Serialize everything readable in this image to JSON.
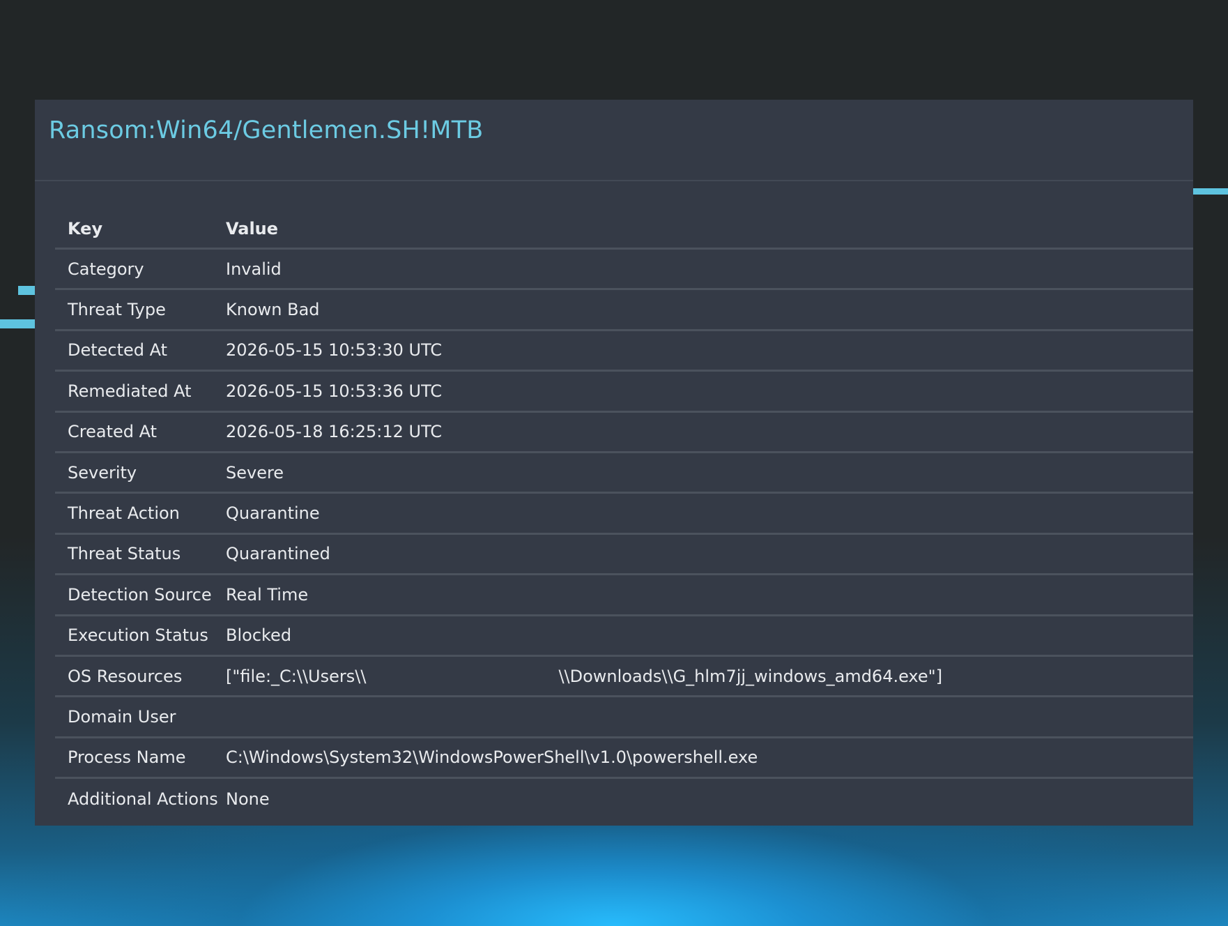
{
  "threat_title": "Ransom:Win64/Gentlemen.SH!MTB",
  "table": {
    "headers": {
      "key": "Key",
      "value": "Value"
    },
    "rows": [
      {
        "key": "Category",
        "value": "Invalid"
      },
      {
        "key": "Threat Type",
        "value": "Known Bad"
      },
      {
        "key": "Detected At",
        "value": "2026-05-15 10:53:30 UTC"
      },
      {
        "key": "Remediated At",
        "value": "2026-05-15 10:53:36 UTC"
      },
      {
        "key": "Created At",
        "value": "2026-05-18 16:25:12 UTC"
      },
      {
        "key": "Severity",
        "value": "Severe"
      },
      {
        "key": "Threat Action",
        "value": "Quarantine"
      },
      {
        "key": "Threat Status",
        "value": "Quarantined"
      },
      {
        "key": "Detection Source",
        "value": "Real Time"
      },
      {
        "key": "Execution Status",
        "value": "Blocked"
      },
      {
        "key": "OS Resources",
        "value_part1": "[\"file:_C:\\\\Users\\\\",
        "value_part2": "\\\\Downloads\\\\G_hlm7jj_windows_amd64.exe\"]"
      },
      {
        "key": "Domain User",
        "value": ""
      },
      {
        "key": "Process Name",
        "value": "C:\\Windows\\System32\\WindowsPowerShell\\v1.0\\powershell.exe"
      },
      {
        "key": "Additional Actions",
        "value": "None"
      }
    ]
  },
  "colors": {
    "title": "#6ccbe3",
    "panel_bg": "#343a46",
    "page_bg": "#222627",
    "accent": "#5ec3df",
    "text": "#e9ebee"
  }
}
